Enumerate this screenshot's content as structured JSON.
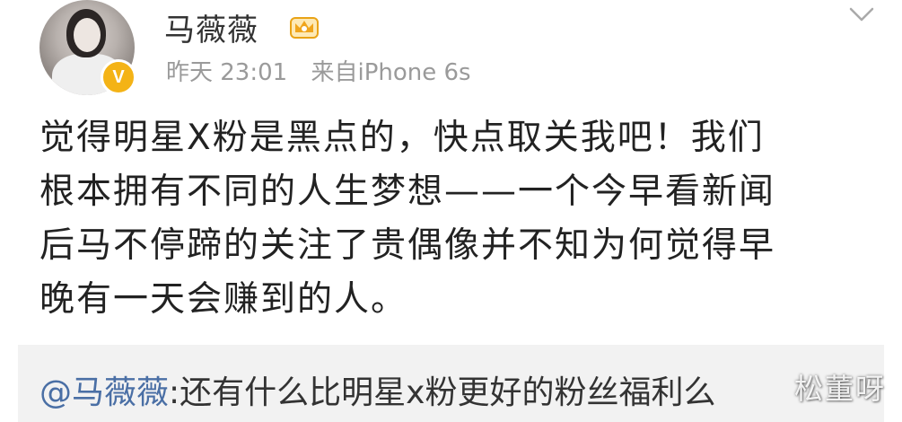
{
  "post": {
    "author": {
      "name": "马薇薇",
      "verified_icon": "verified-v-icon",
      "vip_icon": "crown-icon",
      "verified_label": "V"
    },
    "meta": {
      "time": "昨天 23:01",
      "source": "来自iPhone 6s"
    },
    "text_lines": [
      "觉得明星X粉是黑点的，快点取关我吧！我们",
      "根本拥有不同的人生梦想——一个今早看新闻",
      "后马不停蹄的关注了贵偶像并不知为何觉得早",
      "晚有一天会赚到的人。"
    ],
    "menu_icon": "chevron-down-icon"
  },
  "retweet": {
    "mention": "@马薇薇",
    "text": ":还有什么比明星x粉更好的粉丝福利么"
  },
  "watermark": "松董呀",
  "colors": {
    "badge": "#f4b316",
    "mention": "#4a6fa5",
    "retweet_bg": "#f2f2f2",
    "meta": "#9a9a9a"
  }
}
